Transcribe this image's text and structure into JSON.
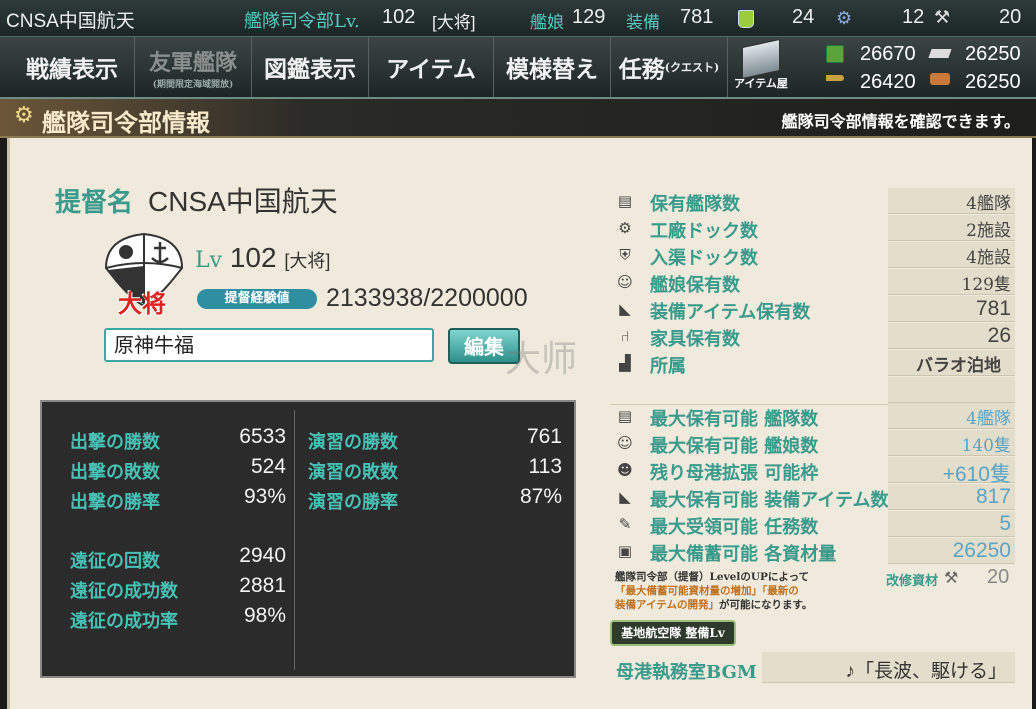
{
  "topbar": {
    "admiral_name": "CNSA中国航天",
    "hq_label": "艦隊司令部Lv.",
    "hq_level": "102",
    "hq_rank": "[大将]",
    "ships_label": "艦娘",
    "ships_count": "129",
    "equip_label": "装備",
    "equip_count": "781",
    "bucket_count": "24",
    "devmat_count": "12",
    "screw_count": "20"
  },
  "menu": {
    "items": [
      {
        "label": "戦績表示"
      },
      {
        "label": "友軍艦隊",
        "sub": "(期間限定海域開放)"
      },
      {
        "label": "図鑑表示"
      },
      {
        "label": "アイテム"
      },
      {
        "label": "模様替え"
      },
      {
        "label": "任務",
        "sub": "(クエスト)"
      }
    ],
    "shop_label": "アイテム屋"
  },
  "resources": {
    "fuel": "26670",
    "ammo": "26250",
    "steel": "26420",
    "bauxite": "26250"
  },
  "header": {
    "title": "艦隊司令部情報",
    "subtitle": "艦隊司令部情報を確認できます。"
  },
  "profile": {
    "name_label": "提督名",
    "name": "CNSA中国航天",
    "emblem_text": "大将",
    "lv_label": "Lv",
    "level": "102",
    "rank": "[大将]",
    "exp_label": "提督経験値",
    "exp_value": "2133938/2200000",
    "comment": "原神牛福",
    "edit_label": "編集",
    "watermark": "大师"
  },
  "stats": {
    "left": [
      {
        "label": "出撃の勝数",
        "value": "6533"
      },
      {
        "label": "出撃の敗数",
        "value": "524"
      },
      {
        "label": "出撃の勝率",
        "value": "93%"
      },
      {
        "label": "遠征の回数",
        "value": "2940"
      },
      {
        "label": "遠征の成功数",
        "value": "2881"
      },
      {
        "label": "遠征の成功率",
        "value": "98%"
      }
    ],
    "right": [
      {
        "label": "演習の勝数",
        "value": "761"
      },
      {
        "label": "演習の敗数",
        "value": "113"
      },
      {
        "label": "演習の勝率",
        "value": "87%"
      }
    ]
  },
  "info": {
    "top": [
      {
        "icon": "fleet-icon",
        "label": "保有艦隊数",
        "value": "4艦隊"
      },
      {
        "icon": "gear-icon",
        "label": "工廠ドック数",
        "value": "2施設"
      },
      {
        "icon": "repair-icon",
        "label": "入渠ドック数",
        "value": "4施設"
      },
      {
        "icon": "shipgirl-icon",
        "label": "艦娘保有数",
        "value": "129隻"
      },
      {
        "icon": "equipment-icon",
        "label": "装備アイテム保有数",
        "value": "781"
      },
      {
        "icon": "furniture-icon",
        "label": "家具保有数",
        "value": "26"
      },
      {
        "icon": "base-icon",
        "label": "所属",
        "value": "バラオ泊地"
      }
    ],
    "max": [
      {
        "icon": "fleet-icon",
        "label": "最大保有可能 艦隊数",
        "value": "4艦隊"
      },
      {
        "icon": "shipgirl-icon",
        "label": "最大保有可能 艦娘数",
        "value": "140隻"
      },
      {
        "icon": "expansion-icon",
        "label": "残り母港拡張 可能枠",
        "value": "+610隻"
      },
      {
        "icon": "equipment-icon",
        "label": "最大保有可能 装備アイテム数",
        "value": "817"
      },
      {
        "icon": "quest-icon",
        "label": "最大受領可能 任務数",
        "value": "5"
      },
      {
        "icon": "storage-icon",
        "label": "最大備蓄可能 各資材量",
        "value": "26250"
      }
    ],
    "note_line1": "艦隊司令部（提督）LevelのUPによって",
    "note_line2_a": "「最大備蓄可能資材量の増加」「最新の",
    "note_line3_a": "装備アイテムの開発」",
    "note_line3_b": "が可能になります。",
    "kaishu_label": "改修資材",
    "kaishu_value": "20",
    "base_button": "基地航空隊 整備Lv",
    "bgm_label": "母港執務室BGM",
    "bgm_value": "♪「長波、駆ける」"
  }
}
